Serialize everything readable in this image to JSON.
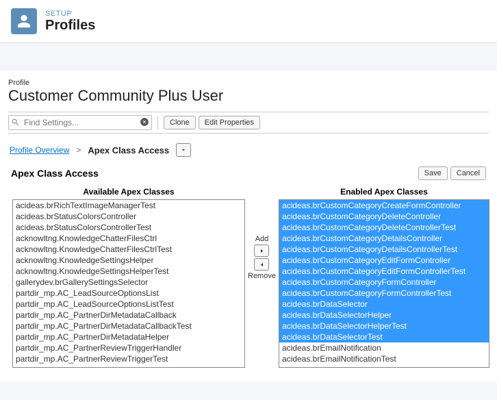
{
  "header": {
    "setup_label": "SETUP",
    "page_title": "Profiles"
  },
  "profile": {
    "caption": "Profile",
    "name": "Customer Community Plus User"
  },
  "search": {
    "placeholder": "Find Settings..."
  },
  "buttons": {
    "clone": "Clone",
    "edit_properties": "Edit Properties",
    "save": "Save",
    "cancel": "Cancel",
    "add": "Add",
    "remove": "Remove"
  },
  "breadcrumb": {
    "overview": "Profile Overview",
    "sep": ">",
    "current": "Apex Class Access"
  },
  "section": {
    "title": "Apex Class Access"
  },
  "lists": {
    "available_label": "Available Apex Classes",
    "enabled_label": "Enabled Apex Classes",
    "available": [
      "acideas.brRichTextImageManagerTest",
      "acideas.brStatusColorsController",
      "acideas.brStatusColorsControllerTest",
      "acknowltng.KnowledgeChatterFilesCtrl",
      "acknowltng.KnowledgeChatterFilesCtrlTest",
      "acknowltng.KnowledgeSettingsHelper",
      "acknowltng.KnowledgeSettingsHelperTest",
      "gallerydev.brGallerySettingsSelector",
      "partdir_mp.AC_LeadSourceOptionsList",
      "partdir_mp.AC_LeadSourceOptionsListTest",
      "partdir_mp.AC_PartnerDirMetadataCallback",
      "partdir_mp.AC_PartnerDirMetadataCallbackTest",
      "partdir_mp.AC_PartnerDirMetadataHelper",
      "partdir_mp.AC_PartnerReviewTriggerHandler",
      "partdir_mp.AC_PartnerReviewTriggerTest"
    ],
    "enabled": [
      {
        "t": "acideas.brCustomCategoryCreateFormController",
        "sel": true
      },
      {
        "t": "acideas.brCustomCategoryDeleteController",
        "sel": true
      },
      {
        "t": "acideas.brCustomCategoryDeleteControllerTest",
        "sel": true
      },
      {
        "t": "acideas.brCustomCategoryDetailsController",
        "sel": true
      },
      {
        "t": "acideas.brCustomCategoryDetailsControllerTest",
        "sel": true
      },
      {
        "t": "acideas.brCustomCategoryEditFormController",
        "sel": true
      },
      {
        "t": "acideas.brCustomCategoryEditFormControllerTest",
        "sel": true
      },
      {
        "t": "acideas.brCustomCategoryFormController",
        "sel": true
      },
      {
        "t": "acideas.brCustomCategoryFormControllerTest",
        "sel": true
      },
      {
        "t": "acideas.brDataSelector",
        "sel": true
      },
      {
        "t": "acideas.brDataSelectorHelper",
        "sel": true
      },
      {
        "t": "acideas.brDataSelectorHelperTest",
        "sel": true
      },
      {
        "t": "acideas.brDataSelectorTest",
        "sel": true
      },
      {
        "t": "acideas.brEmailNotification",
        "sel": false
      },
      {
        "t": "acideas.brEmailNotificationTest",
        "sel": false
      }
    ]
  }
}
